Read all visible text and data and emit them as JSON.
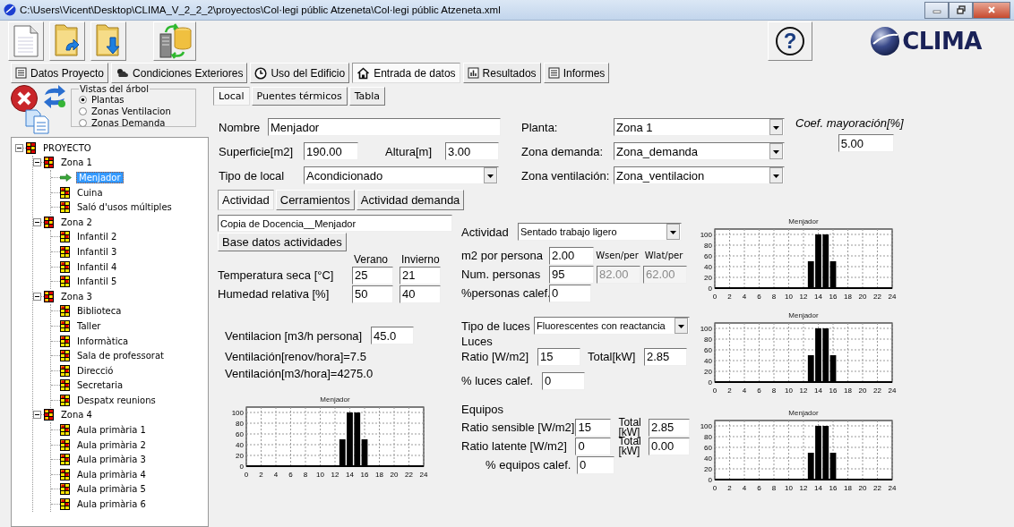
{
  "window": {
    "title": "C:\\Users\\Vicent\\Desktop\\CLIMA_V_2_2_2\\proyectos\\Col·legi públic Atzeneta\\Col·legi públic Atzeneta.xml"
  },
  "help_button": {
    "label": "?"
  },
  "logo": {
    "text": "CLIMA"
  },
  "main_tabs": [
    {
      "label": "Datos Proyecto",
      "kind": "list",
      "selected": false
    },
    {
      "label": "Condiciones Exteriores",
      "kind": "weather",
      "selected": false
    },
    {
      "label": "Uso del Edificio",
      "kind": "clock",
      "selected": false
    },
    {
      "label": "Entrada de datos",
      "kind": "house",
      "selected": true
    },
    {
      "label": "Resultados",
      "kind": "chart",
      "selected": false
    },
    {
      "label": "Informes",
      "kind": "list",
      "selected": false
    }
  ],
  "tree_views": {
    "title": "Vistas del árbol",
    "options": [
      {
        "label": "Plantas",
        "selected": true
      },
      {
        "label": "Zonas Ventilacion",
        "selected": false
      },
      {
        "label": "Zonas Demanda",
        "selected": false
      }
    ]
  },
  "tree": [
    {
      "label": "PROYECTO",
      "expanded": true,
      "selected": false,
      "children": [
        {
          "label": "Zona 1",
          "expanded": true,
          "selected": false,
          "children": [
            {
              "label": "Menjador",
              "selected": true
            },
            {
              "label": "Cuina",
              "selected": false
            },
            {
              "label": "Saló d'usos múltiples",
              "selected": false
            }
          ]
        },
        {
          "label": "Zona 2",
          "expanded": true,
          "selected": false,
          "children": [
            {
              "label": "Infantil 2",
              "selected": false
            },
            {
              "label": "Infantil 3",
              "selected": false
            },
            {
              "label": "Infantil 4",
              "selected": false
            },
            {
              "label": "Infantil 5",
              "selected": false
            }
          ]
        },
        {
          "label": "Zona 3",
          "expanded": true,
          "selected": false,
          "children": [
            {
              "label": "Biblioteca",
              "selected": false
            },
            {
              "label": "Taller",
              "selected": false
            },
            {
              "label": "Informàtica",
              "selected": false
            },
            {
              "label": "Sala de professorat",
              "selected": false
            },
            {
              "label": "Direcció",
              "selected": false
            },
            {
              "label": "Secretaria",
              "selected": false
            },
            {
              "label": "Despatx reunions",
              "selected": false
            }
          ]
        },
        {
          "label": "Zona 4",
          "expanded": true,
          "selected": false,
          "children": [
            {
              "label": "Aula primària 1",
              "selected": false
            },
            {
              "label": "Aula primària 2",
              "selected": false
            },
            {
              "label": "Aula primària 3",
              "selected": false
            },
            {
              "label": "Aula primària 4",
              "selected": false
            },
            {
              "label": "Aula primària 5",
              "selected": false
            },
            {
              "label": "Aula primària 6",
              "selected": false
            }
          ]
        }
      ]
    }
  ],
  "sub_tabs": [
    {
      "label": "Local",
      "selected": true
    },
    {
      "label": "Puentes térmicos",
      "selected": false
    },
    {
      "label": "Tabla",
      "selected": false
    }
  ],
  "local": {
    "nombre": {
      "label": "Nombre",
      "value": "Menjador"
    },
    "superficie": {
      "label": "Superficie[m2]",
      "value": "190.00"
    },
    "altura": {
      "label": "Altura[m]",
      "value": "3.00"
    },
    "tipo_local": {
      "label": "Tipo de local",
      "value": "Acondicionado"
    },
    "planta": {
      "label": "Planta:",
      "value": "Zona 1"
    },
    "zona_demanda": {
      "label": "Zona demanda:",
      "value": "Zona_demanda"
    },
    "zona_ventilacion": {
      "label": "Zona ventilación:",
      "value": "Zona_ventilacion"
    },
    "coef_mayoracion": {
      "label": "Coef. mayoración[%]",
      "value": "5.00"
    }
  },
  "activity_tabs": [
    {
      "label": "Actividad",
      "selected": true
    },
    {
      "label": "Cerramientos",
      "selected": false
    },
    {
      "label": "Actividad demanda",
      "selected": false
    }
  ],
  "occupancy": {
    "activity_name": "Copia de Docencia__Menjador",
    "database_button": "Base datos actividades",
    "season_columns": [
      "Verano",
      "Invierno"
    ],
    "conditions": [
      {
        "label": "Temperatura seca [°C]",
        "values": [
          "25",
          "21"
        ]
      },
      {
        "label": "Humedad relativa [%]",
        "values": [
          "50",
          "40"
        ]
      }
    ],
    "ventilation": {
      "label": "Ventilacion [m3/h persona]",
      "value": "45.0"
    },
    "ventilation_results": [
      "Ventilación[renov/hora]=7.5",
      "Ventilación[m3/hora]=4275.0"
    ],
    "chart_data": {
      "type": "bar",
      "grid": true,
      "title": "Menjador",
      "x": [
        0,
        1,
        2,
        3,
        4,
        5,
        6,
        7,
        8,
        9,
        10,
        11,
        12,
        13,
        14,
        15,
        16,
        17,
        18,
        19,
        20,
        21,
        22,
        23
      ],
      "values": [
        0,
        0,
        0,
        0,
        0,
        0,
        0,
        0,
        0,
        0,
        0,
        0,
        0,
        50,
        100,
        100,
        50,
        0,
        0,
        0,
        0,
        0,
        0,
        0
      ],
      "xlim": [
        0,
        24
      ],
      "ylim": [
        0,
        110
      ],
      "xticks": [
        0,
        2,
        4,
        6,
        8,
        10,
        12,
        14,
        16,
        18,
        20,
        22,
        24
      ],
      "yticks": [
        0,
        20,
        40,
        60,
        80,
        100
      ]
    }
  },
  "people": {
    "actividad": {
      "label": "Actividad",
      "value": "Sentado trabajo ligero"
    },
    "m2_por_persona": {
      "label": "m2 por persona",
      "value": "2.00"
    },
    "heat_columns": [
      "Wsen/per",
      "Wlat/per"
    ],
    "num_personas": {
      "label": "Num. personas",
      "value": "95"
    },
    "heat_values": [
      {
        "value": "82.00",
        "disabled": true
      },
      {
        "value": "62.00",
        "disabled": true
      }
    ],
    "calef": {
      "label": "%personas calef.",
      "value": "0"
    },
    "chart_data": {
      "type": "bar",
      "grid": true,
      "title": "Menjador",
      "x": [
        0,
        1,
        2,
        3,
        4,
        5,
        6,
        7,
        8,
        9,
        10,
        11,
        12,
        13,
        14,
        15,
        16,
        17,
        18,
        19,
        20,
        21,
        22,
        23
      ],
      "values": [
        0,
        0,
        0,
        0,
        0,
        0,
        0,
        0,
        0,
        0,
        0,
        0,
        0,
        50,
        100,
        100,
        50,
        0,
        0,
        0,
        0,
        0,
        0,
        0
      ],
      "xlim": [
        0,
        24
      ],
      "ylim": [
        0,
        110
      ],
      "xticks": [
        0,
        2,
        4,
        6,
        8,
        10,
        12,
        14,
        16,
        18,
        20,
        22,
        24
      ],
      "yticks": [
        0,
        20,
        40,
        60,
        80,
        100
      ]
    }
  },
  "lighting": {
    "tipo": {
      "label": "Tipo de luces",
      "value": "Fluorescentes con reactancia"
    },
    "heading": "Luces",
    "ratio": {
      "label": "Ratio [W/m2]",
      "value": "15"
    },
    "total": {
      "label": "Total[kW]",
      "value": "2.85"
    },
    "calef": {
      "label": "% luces calef.",
      "value": "0"
    },
    "chart_data": {
      "type": "bar",
      "grid": true,
      "title": "Menjador",
      "x": [
        0,
        1,
        2,
        3,
        4,
        5,
        6,
        7,
        8,
        9,
        10,
        11,
        12,
        13,
        14,
        15,
        16,
        17,
        18,
        19,
        20,
        21,
        22,
        23
      ],
      "values": [
        0,
        0,
        0,
        0,
        0,
        0,
        0,
        0,
        0,
        0,
        0,
        0,
        0,
        50,
        100,
        100,
        50,
        0,
        0,
        0,
        0,
        0,
        0,
        0
      ],
      "xlim": [
        0,
        24
      ],
      "ylim": [
        0,
        110
      ],
      "xticks": [
        0,
        2,
        4,
        6,
        8,
        10,
        12,
        14,
        16,
        18,
        20,
        22,
        24
      ],
      "yticks": [
        0,
        20,
        40,
        60,
        80,
        100
      ]
    }
  },
  "equipment": {
    "heading": "Equipos",
    "rows": [
      {
        "label": "Ratio sensible [W/m2]",
        "value": "15",
        "total_label": "Total [kW]",
        "total": "2.85"
      },
      {
        "label": "Ratio latente [W/m2]",
        "value": "0",
        "total_label": "Total [kW]",
        "total": "0.00"
      }
    ],
    "calef": {
      "label": "% equipos calef.",
      "value": "0"
    },
    "chart_data": {
      "type": "bar",
      "grid": true,
      "title": "Menjador",
      "x": [
        0,
        1,
        2,
        3,
        4,
        5,
        6,
        7,
        8,
        9,
        10,
        11,
        12,
        13,
        14,
        15,
        16,
        17,
        18,
        19,
        20,
        21,
        22,
        23
      ],
      "values": [
        0,
        0,
        0,
        0,
        0,
        0,
        0,
        0,
        0,
        0,
        0,
        0,
        0,
        50,
        100,
        100,
        50,
        0,
        0,
        0,
        0,
        0,
        0,
        0
      ],
      "xlim": [
        0,
        24
      ],
      "ylim": [
        0,
        110
      ],
      "xticks": [
        0,
        2,
        4,
        6,
        8,
        10,
        12,
        14,
        16,
        18,
        20,
        22,
        24
      ],
      "yticks": [
        0,
        20,
        40,
        60,
        80,
        100
      ]
    }
  }
}
